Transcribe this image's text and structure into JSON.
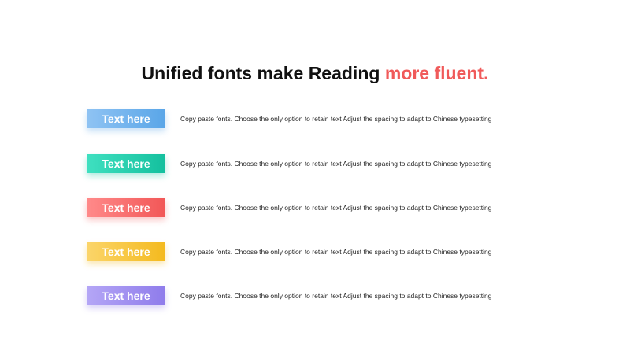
{
  "title": {
    "main": "Unified fonts make Reading",
    "accent": "more fluent."
  },
  "items": [
    {
      "label": "Text here",
      "text": "Copy paste fonts. Choose the only option to retain text Adjust the spacing to adapt to Chinese typesetting",
      "color_from": "#8fc3f3",
      "color_to": "#5aa6e8"
    },
    {
      "label": "Text here",
      "text": "Copy paste fonts. Choose the only option to retain text Adjust the spacing to adapt to Chinese typesetting",
      "color_from": "#3fe0c0",
      "color_to": "#14c09e"
    },
    {
      "label": "Text here",
      "text": "Copy paste fonts. Choose the only option to retain text Adjust the spacing to adapt to Chinese typesetting",
      "color_from": "#ff8a8a",
      "color_to": "#f25757"
    },
    {
      "label": "Text here",
      "text": "Copy paste fonts. Choose the only option to retain text Adjust the spacing to adapt to Chinese typesetting",
      "color_from": "#fbd56a",
      "color_to": "#f4ba1e"
    },
    {
      "label": "Text here",
      "text": "Copy paste fonts. Choose the only option to retain text Adjust the spacing to adapt to Chinese typesetting",
      "color_from": "#b4a6f6",
      "color_to": "#8f7ceb"
    }
  ]
}
